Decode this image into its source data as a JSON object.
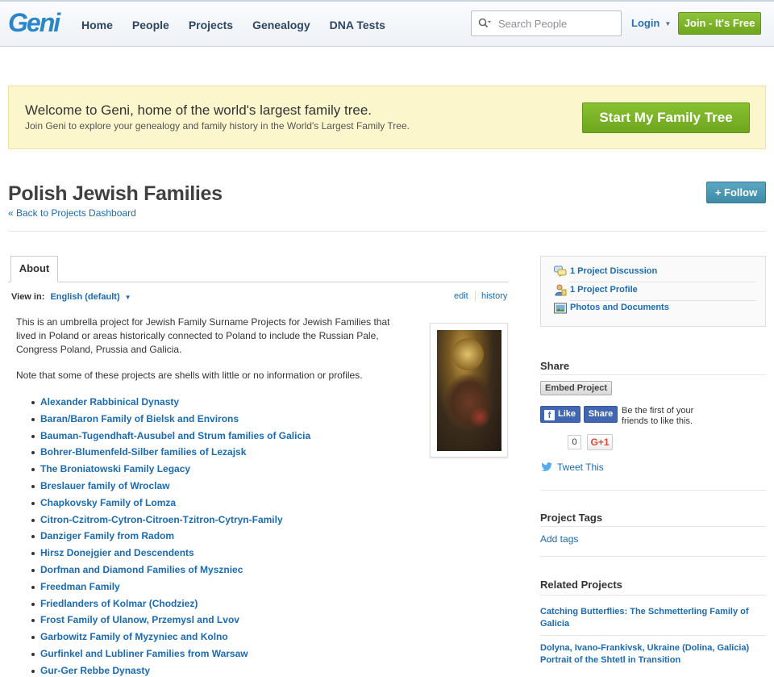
{
  "header": {
    "logo": "Geni",
    "nav": [
      "Home",
      "People",
      "Projects",
      "Genealogy",
      "DNA Tests"
    ],
    "search_placeholder": "Search People",
    "login_label": "Login",
    "join_label": "Join - It's Free"
  },
  "welcome": {
    "heading": "Welcome to Geni, home of the world's largest family tree.",
    "sub": "Join Geni to explore your genealogy and family history in the World's Largest Family Tree.",
    "cta_label": "Start My Family Tree"
  },
  "project": {
    "title": "Polish Jewish Families",
    "back_link": "« Back to Projects Dashboard",
    "follow_label": "+ Follow"
  },
  "about": {
    "tab_label": "About",
    "view_in_label": "View in:",
    "language": "English (default)",
    "edit_label": "edit",
    "history_label": "history",
    "description": "This is an umbrella project for Jewish Family Surname Projects for Jewish Families that lived in Poland or areas historically connected to Poland to include the Russian Pale, Congress Poland, Prussia and Galicia.",
    "note": "Note that some of these projects are shells with little or no information or profiles.",
    "projects": [
      "Alexander Rabbinical Dynasty",
      "Baran/Baron Family of Bielsk and Environs",
      "Bauman-Tugendhaft-Ausubel and Strum families of Galicia",
      "Bohrer-Blumenfeld-Silber families of Lezajsk",
      "The Broniatowski Family Legacy",
      "Breslauer family of Wroclaw",
      "Chapkovsky Family of Lomza",
      "Citron-Czitrom-Cytron-Citroen-Tzitron-Cytryn-Family",
      "Danziger Family from Radom",
      "Hirsz Donejgier and Descendents",
      "Dorfman and Diamond Families of Myszniec",
      "Freedman Family",
      "Friedlanders of Kolmar (Chodziez)",
      "Frost Family of Ulanow, Przemysl and Lvov",
      "Garbowitz Family of Myzyniec and Kolno",
      "Gurfinkel and Lubliner Families from Warsaw",
      "Gur-Ger Rebbe Dynasty"
    ]
  },
  "sidebar": {
    "links": [
      {
        "label": "1 Project Discussion",
        "icon": "discussion-icon"
      },
      {
        "label": "1 Project Profile",
        "icon": "profile-icon"
      },
      {
        "label": "Photos and Documents",
        "icon": "photos-icon"
      }
    ],
    "share_heading": "Share",
    "embed_label": "Embed Project",
    "fb_like": "Like",
    "fb_share": "Share",
    "fb_text": "Be the first of your friends to like this.",
    "gplus_count": "0",
    "gplus_label": "G+1",
    "tweet_label": "Tweet This",
    "tags_heading": "Project Tags",
    "add_tags": "Add tags",
    "related_heading": "Related Projects",
    "related": [
      "Catching Butterflies: The Schmetterling Family of Galicia",
      "Dolyna, Ivano-Frankivsk, Ukraine (Dolina, Galicia) Portrait of the Shtetl in Transition"
    ]
  }
}
